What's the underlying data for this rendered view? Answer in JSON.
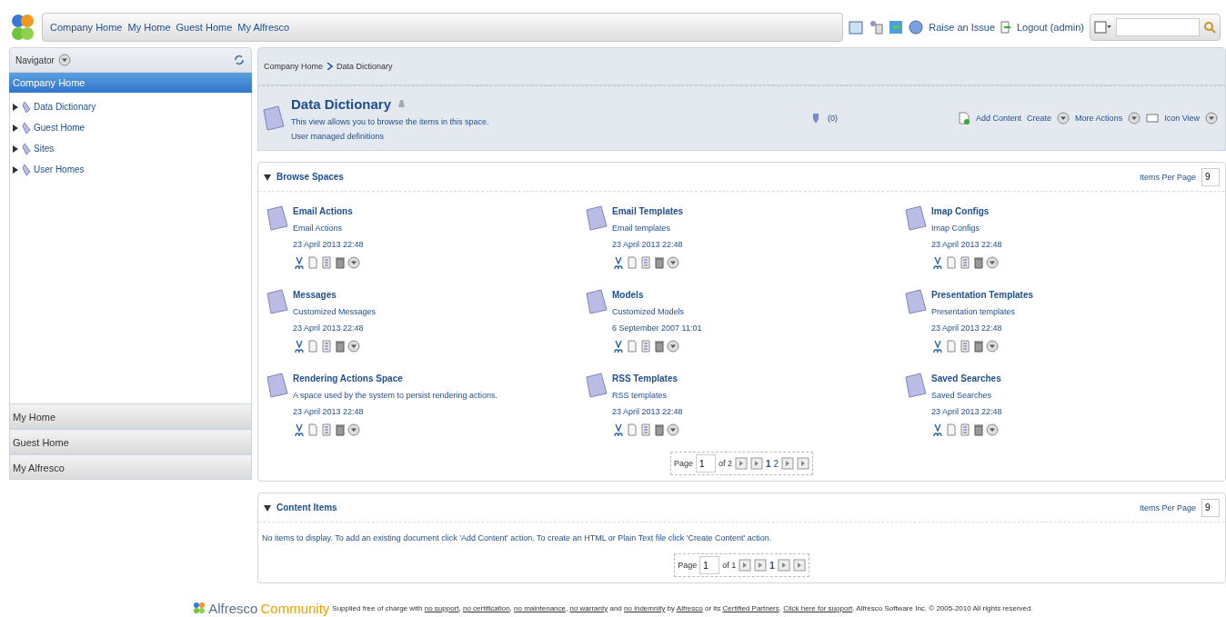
{
  "top_links": [
    "Company Home",
    "My Home",
    "Guest Home",
    "My Alfresco"
  ],
  "top_actions": {
    "raise_issue": "Raise an Issue",
    "logout": "Logout (admin)"
  },
  "navigator": {
    "title": "Navigator",
    "selected_space": "Company Home",
    "tree": [
      {
        "label": "Data Dictionary",
        "expanded": false
      },
      {
        "label": "Guest Home",
        "expanded": false
      },
      {
        "label": "Sites",
        "expanded": false
      },
      {
        "label": "User Homes",
        "expanded": false
      }
    ],
    "panels": [
      "My Home",
      "Guest Home",
      "My Alfresco"
    ]
  },
  "breadcrumb": [
    "Company Home",
    "Data Dictionary"
  ],
  "space": {
    "title": "Data Dictionary",
    "description": "This view allows you to browse the items in this space.",
    "subtitle": "User managed definitions",
    "rules_count": "(0)",
    "actions": {
      "add_content": "Add Content",
      "create": "Create",
      "more_actions": "More Actions",
      "view": "Icon View"
    }
  },
  "browse_spaces": {
    "title": "Browse Spaces",
    "items_per_page_label": "Items Per Page",
    "items_per_page": "9",
    "items": [
      {
        "name": "Email Actions",
        "description": "Email Actions",
        "date": "23 April 2013 22:48"
      },
      {
        "name": "Email Templates",
        "description": "Email templates",
        "date": "23 April 2013 22:48"
      },
      {
        "name": "Imap Configs",
        "description": "Imap Configs",
        "date": "23 April 2013 22:48"
      },
      {
        "name": "Messages",
        "description": "Customized Messages",
        "date": "23 April 2013 22:48"
      },
      {
        "name": "Models",
        "description": "Customized Models",
        "date": "6 September 2007 11:01"
      },
      {
        "name": "Presentation Templates",
        "description": "Presentation templates",
        "date": "23 April 2013 22:48"
      },
      {
        "name": "Rendering Actions Space",
        "description": "A space used by the system to persist rendering actions.",
        "date": "23 April 2013 22:48"
      },
      {
        "name": "RSS Templates",
        "description": "RSS templates",
        "date": "23 April 2013 22:48"
      },
      {
        "name": "Saved Searches",
        "description": "Saved Searches",
        "date": "23 April 2013 22:48"
      }
    ],
    "pager": {
      "label": "Page",
      "page": "1",
      "of": "of 2",
      "pages": [
        {
          "label": "1",
          "selected": true
        },
        {
          "label": "2",
          "selected": false
        }
      ]
    }
  },
  "content_items": {
    "title": "Content Items",
    "items_per_page_label": "Items Per Page",
    "items_per_page": "9",
    "empty_message": "No items to display. To add an existing document click 'Add Content' action. To create an HTML or Plain Text file click 'Create Content' action.",
    "pager": {
      "label": "Page",
      "page": "1",
      "of": "of 1",
      "pages": [
        {
          "label": "1",
          "selected": true
        }
      ]
    }
  },
  "footer": {
    "brand": "Alfresco",
    "edition": "Community",
    "intro": "Supplied free of charge with ",
    "links": [
      {
        "text": "no support",
        "after": ", "
      },
      {
        "text": "no certification",
        "after": ", "
      },
      {
        "text": "no maintenance",
        "after": ", "
      },
      {
        "text": "no warranty",
        "after": " and "
      },
      {
        "text": "no indemnity",
        "after": " by "
      },
      {
        "text": "Alfresco",
        "after": " or its "
      },
      {
        "text": "Certified Partners",
        "after": ". "
      },
      {
        "text": "Click here for support",
        "after": ". Alfresco Software Inc. © 2005-2010 All rights reserved."
      }
    ]
  }
}
